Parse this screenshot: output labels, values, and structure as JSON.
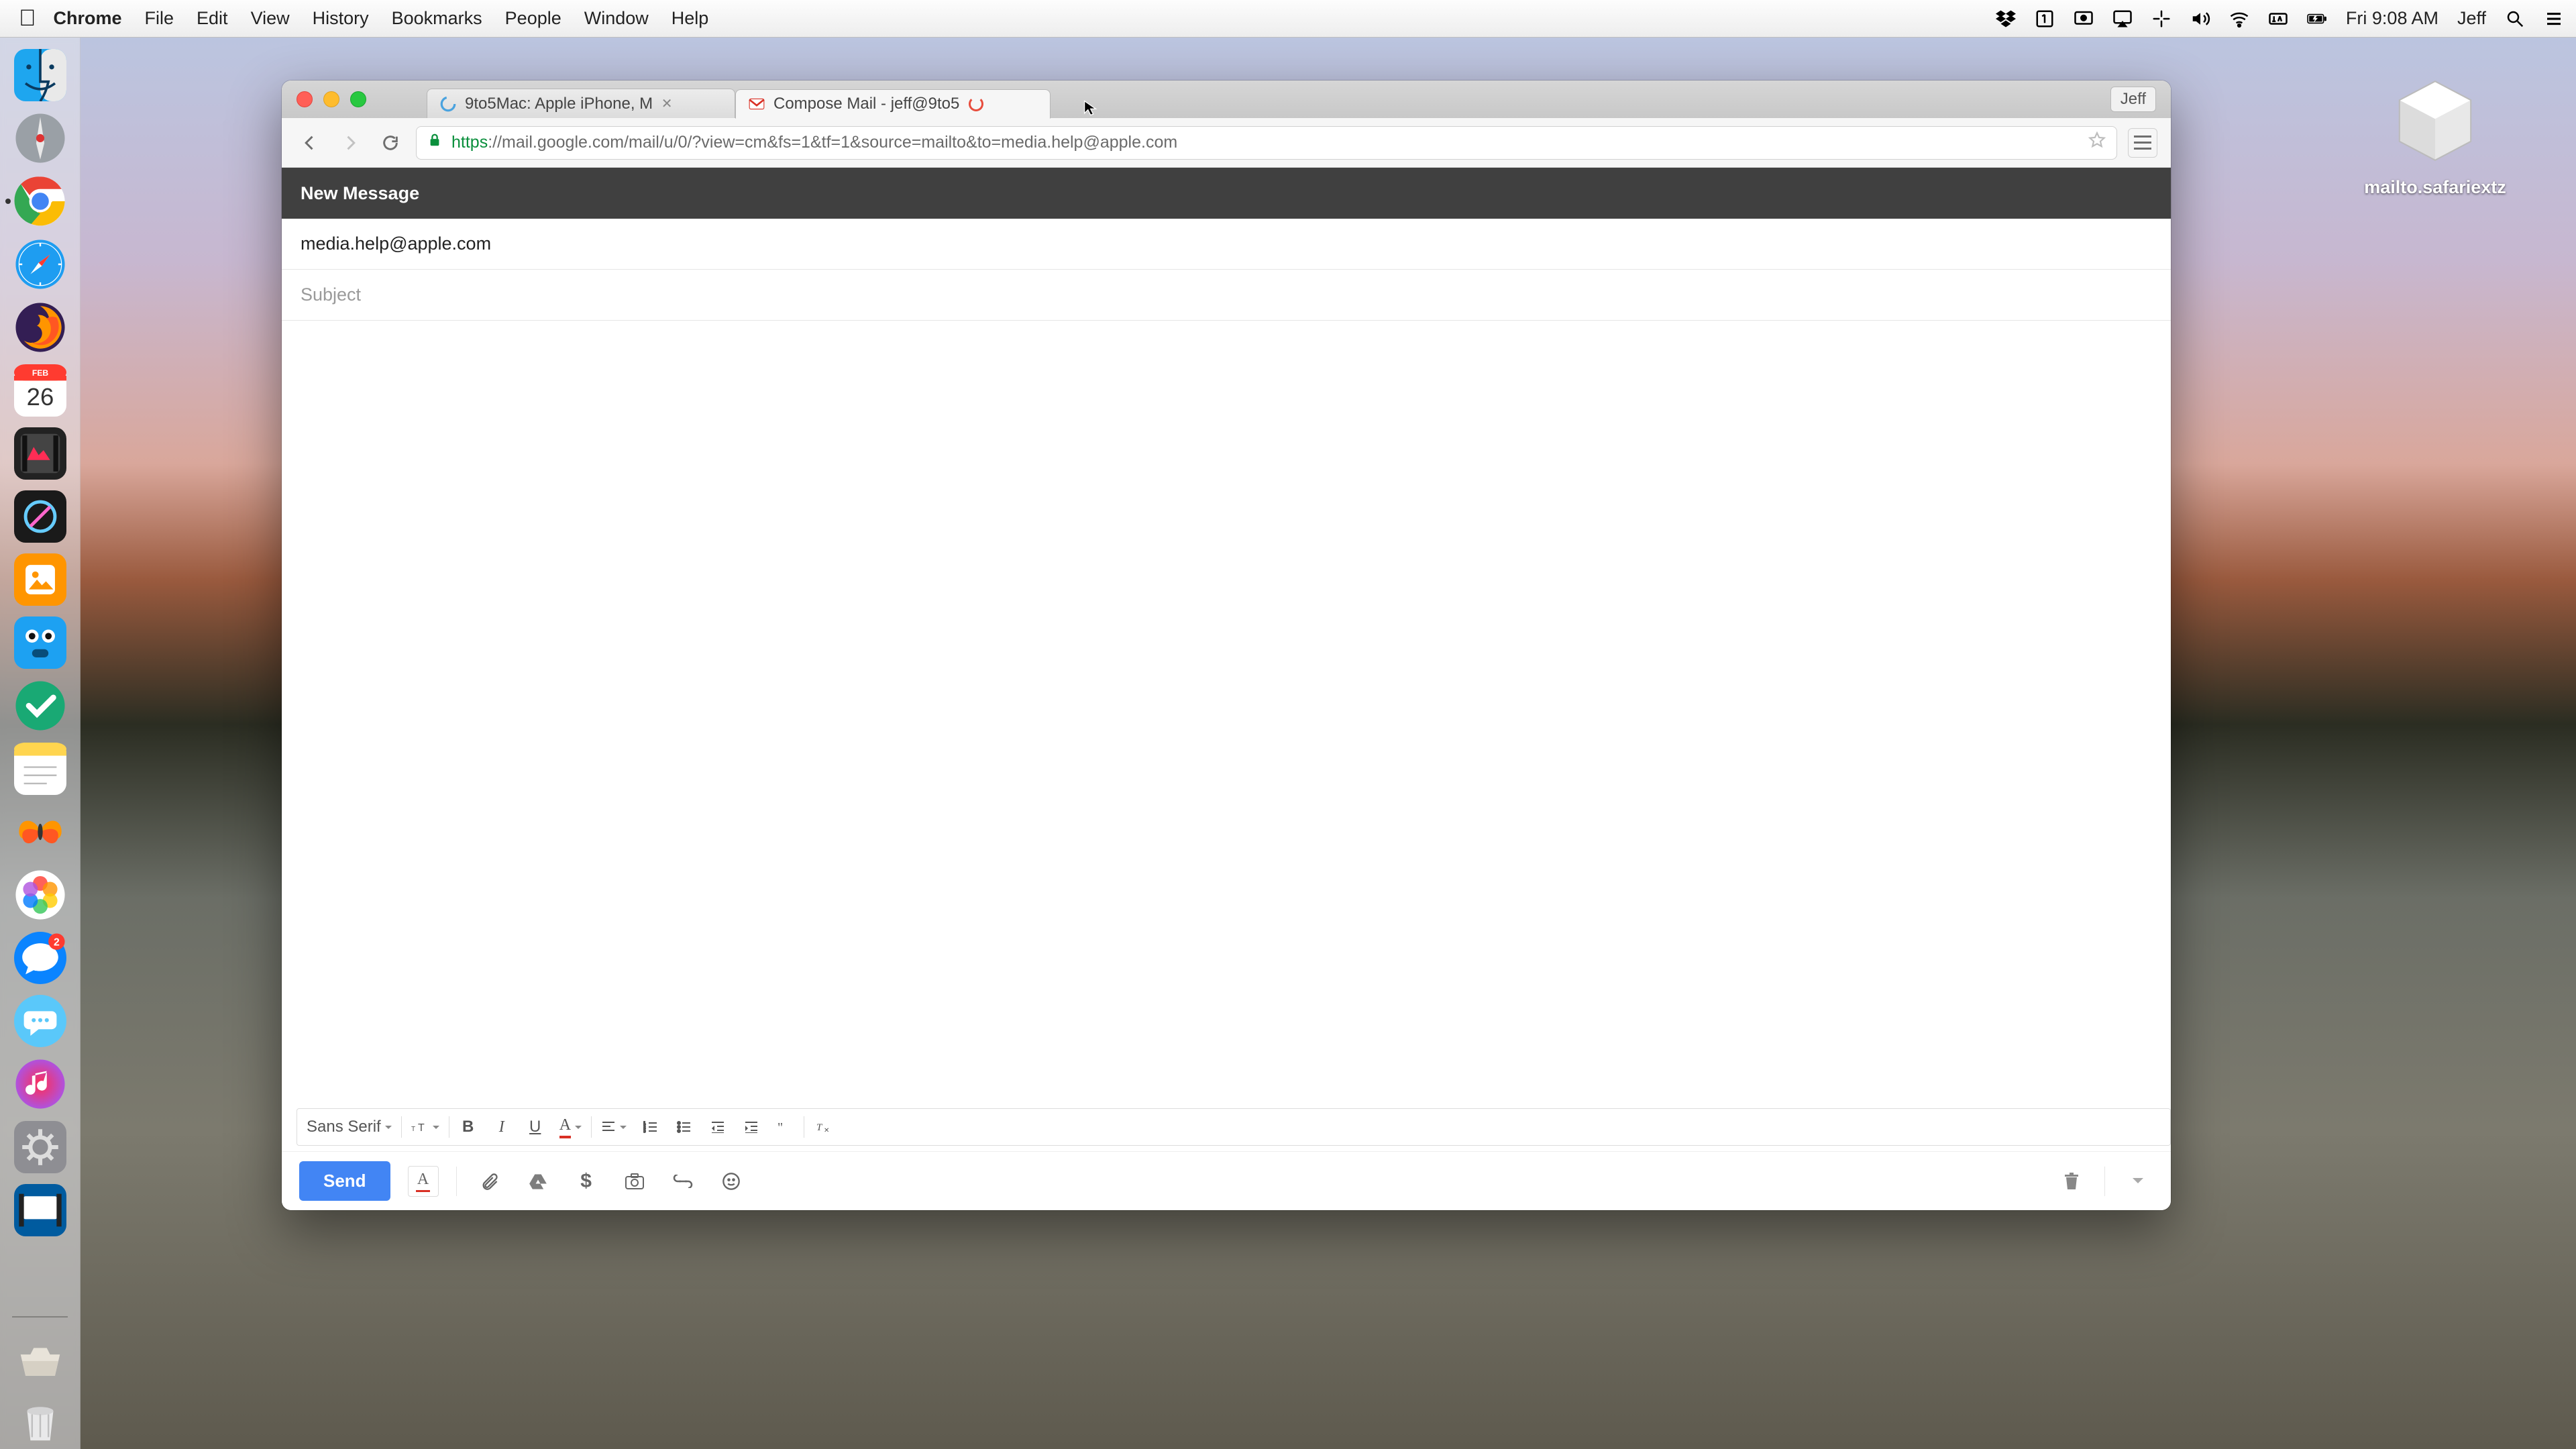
{
  "menubar": {
    "app_name": "Chrome",
    "items": [
      "File",
      "Edit",
      "View",
      "History",
      "Bookmarks",
      "People",
      "Window",
      "Help"
    ],
    "clock": "Fri 9:08 AM",
    "user": "Jeff"
  },
  "dock": {
    "items": [
      {
        "name": "finder"
      },
      {
        "name": "launchpad"
      },
      {
        "name": "chrome",
        "running": true
      },
      {
        "name": "safari"
      },
      {
        "name": "firefox"
      },
      {
        "name": "calendar",
        "day": "26"
      },
      {
        "name": "final-cut"
      },
      {
        "name": "pixelmator"
      },
      {
        "name": "napkin"
      },
      {
        "name": "tweetbot"
      },
      {
        "name": "things"
      },
      {
        "name": "notes"
      },
      {
        "name": "delicious-library"
      },
      {
        "name": "photos"
      },
      {
        "name": "messages"
      },
      {
        "name": "screens"
      },
      {
        "name": "itunes"
      },
      {
        "name": "system-preferences"
      },
      {
        "name": "screenflow"
      }
    ],
    "footer": [
      {
        "name": "downloads"
      },
      {
        "name": "trash"
      }
    ]
  },
  "desktop": {
    "file_label": "mailto.safariextz"
  },
  "chrome": {
    "profile_label": "Jeff",
    "tabs": [
      {
        "title": "9to5Mac: Apple iPhone, M",
        "icon": "spinner-blue",
        "active": false
      },
      {
        "title": "Compose Mail - jeff@9to5",
        "icon": "gmail",
        "active": true,
        "loading_red": true
      }
    ],
    "url_https": "https",
    "url_rest": "://mail.google.com/mail/u/0/?view=cm&fs=1&tf=1&source=mailto&to=media.help@apple.com"
  },
  "compose": {
    "header": "New Message",
    "to": "media.help@apple.com",
    "subject_placeholder": "Subject",
    "font_label": "Sans Serif",
    "send_label": "Send"
  }
}
